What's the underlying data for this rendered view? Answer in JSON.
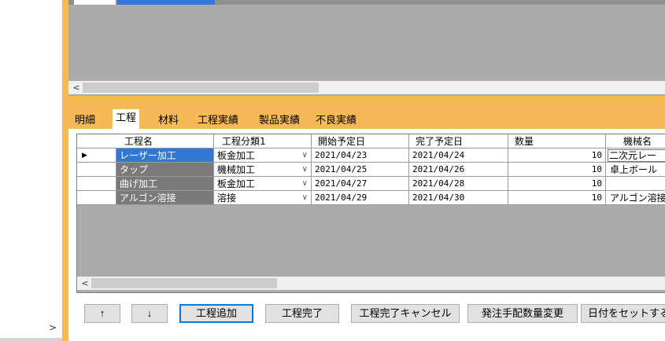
{
  "tabs": [
    {
      "label": "明細"
    },
    {
      "label": "工程"
    },
    {
      "label": "材料"
    },
    {
      "label": "工程実績"
    },
    {
      "label": "製品実績"
    },
    {
      "label": "不良実績"
    }
  ],
  "grid": {
    "columns": [
      "工程名",
      "工程分類1",
      "開始予定日",
      "完了予定日",
      "数量",
      "機械名"
    ],
    "rows": [
      {
        "selector": "▶",
        "name": "レーザー加工",
        "category": "板金加工",
        "start": "2021/04/23",
        "end": "2021/04/24",
        "qty": "10",
        "machine": "二次元レー"
      },
      {
        "selector": "",
        "name": "タップ",
        "category": "機械加工",
        "start": "2021/04/25",
        "end": "2021/04/26",
        "qty": "10",
        "machine": "卓上ボール"
      },
      {
        "selector": "",
        "name": "曲げ加工",
        "category": "板金加工",
        "start": "2021/04/27",
        "end": "2021/04/28",
        "qty": "10",
        "machine": ""
      },
      {
        "selector": "",
        "name": "アルゴン溶接",
        "category": "溶接",
        "start": "2021/04/29",
        "end": "2021/04/30",
        "qty": "10",
        "machine": "アルゴン溶接"
      }
    ]
  },
  "buttons": {
    "up": "↑",
    "down": "↓",
    "add_process": "工程追加",
    "complete_process": "工程完了",
    "cancel_complete": "工程完了キャンセル",
    "change_order_qty": "発注手配数量変更",
    "set_date": "日付をセットする"
  },
  "icons": {
    "scroll_left": "<",
    "expand": ">",
    "dropdown": "∨"
  },
  "colors": {
    "accent_orange": "#f5b955",
    "selection_blue": "#3078d4",
    "readonly_gray": "#7a7a7a"
  }
}
